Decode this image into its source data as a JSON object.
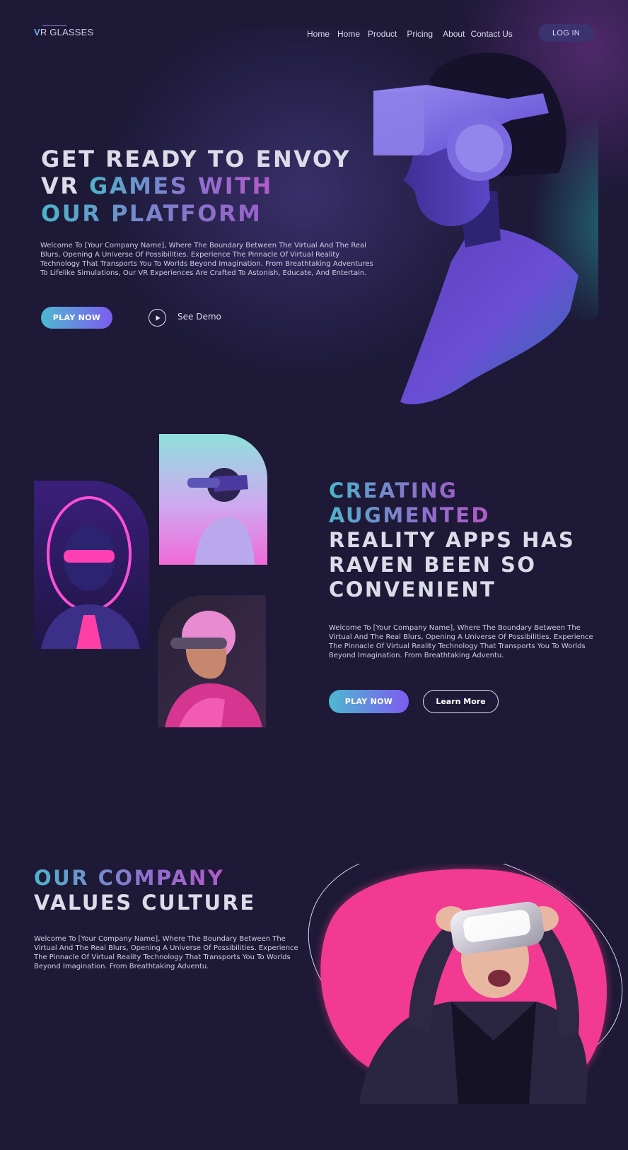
{
  "brand": {
    "logo_initial": "V",
    "logo_rest": "R GLASSES"
  },
  "nav": {
    "items": [
      "Home",
      "Home",
      "Product",
      "Pricing",
      "About",
      "Contact Us"
    ],
    "login_label": "LOG IN"
  },
  "hero": {
    "title_line1": "GET READY TO ENVOY",
    "title_line2_a": "VR ",
    "title_line2_b": "GAMES WITH",
    "title_line3": "OUR PLATFORM",
    "body": "Welcome To [Your Company Name], Where The Boundary Between The Virtual And The Real Blurs, Opening A Universe Of Possibilities. Experience The Pinnacle Of Virtual Reality Technology That Transports You To Worlds Beyond Imagination. From Breathtaking Adventures To Lifelike Simulations, Our VR Experiences Are Crafted To Astonish, Educate, And Entertain.",
    "play_label": "PLAY NOW",
    "demo_label": "See Demo"
  },
  "section2": {
    "title_line1": "CREATING",
    "title_line2": "AUGMENTED",
    "title_line3": "REALITY APPS HAS",
    "title_line4": "RAVEN BEEN SO",
    "title_line5": "CONVENIENT",
    "body": "Welcome To [Your Company Name], Where The Boundary Between The Virtual And The Real Blurs, Opening A Universe Of Possibilities. Experience The Pinnacle Of Virtual Reality Technology That Transports You To Worlds Beyond Imagination. From Breathtaking Adventu.",
    "play_label": "PLAY NOW",
    "learn_label": "Learn More"
  },
  "section3": {
    "title_line1": "OUR COMPANY",
    "title_line2": "VALUES CULTURE",
    "body": "Welcome To [Your Company Name], Where The Boundary Between The Virtual And The Real Blurs, Opening A Universe Of Possibilities. Experience The Pinnacle Of Virtual Reality Technology That Transports You To Worlds Beyond Imagination. From Breathtaking Adventu."
  },
  "colors": {
    "background": "#1d1937",
    "accent_cyan": "#4db8d0",
    "accent_purple": "#7c5cf0",
    "accent_pink": "#f23a93"
  }
}
